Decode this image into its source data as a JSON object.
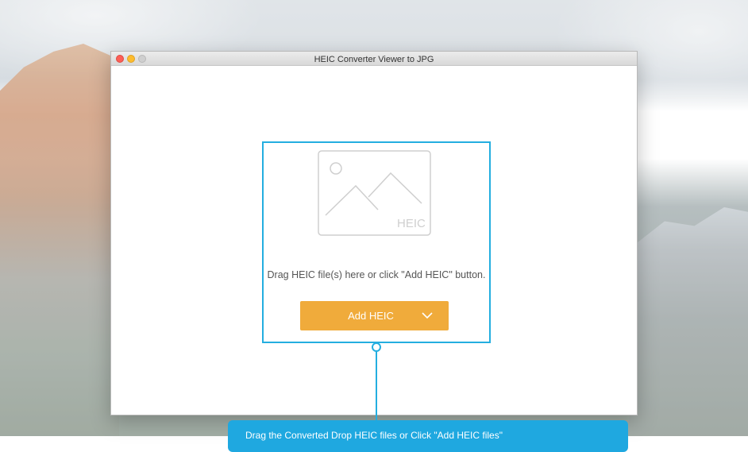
{
  "window": {
    "title": "HEIC Converter Viewer to JPG"
  },
  "dropzone": {
    "placeholder_icon": "image-placeholder-icon",
    "watermark": "HEIC",
    "instruction": "Drag HEIC file(s) here or click \"Add HEIC\" button."
  },
  "add_button": {
    "label": "Add HEIC",
    "dropdown_icon": "chevron-down-icon"
  },
  "callout": {
    "text": "Drag the Converted Drop HEIC files or Click \"Add HEIC files\""
  },
  "colors": {
    "accent_blue": "#24aee0",
    "button_orange": "#f0ab3b",
    "traffic_close": "#fc5f57",
    "traffic_minimize": "#fdbc2e",
    "traffic_zoom": "#cfcfcf"
  }
}
